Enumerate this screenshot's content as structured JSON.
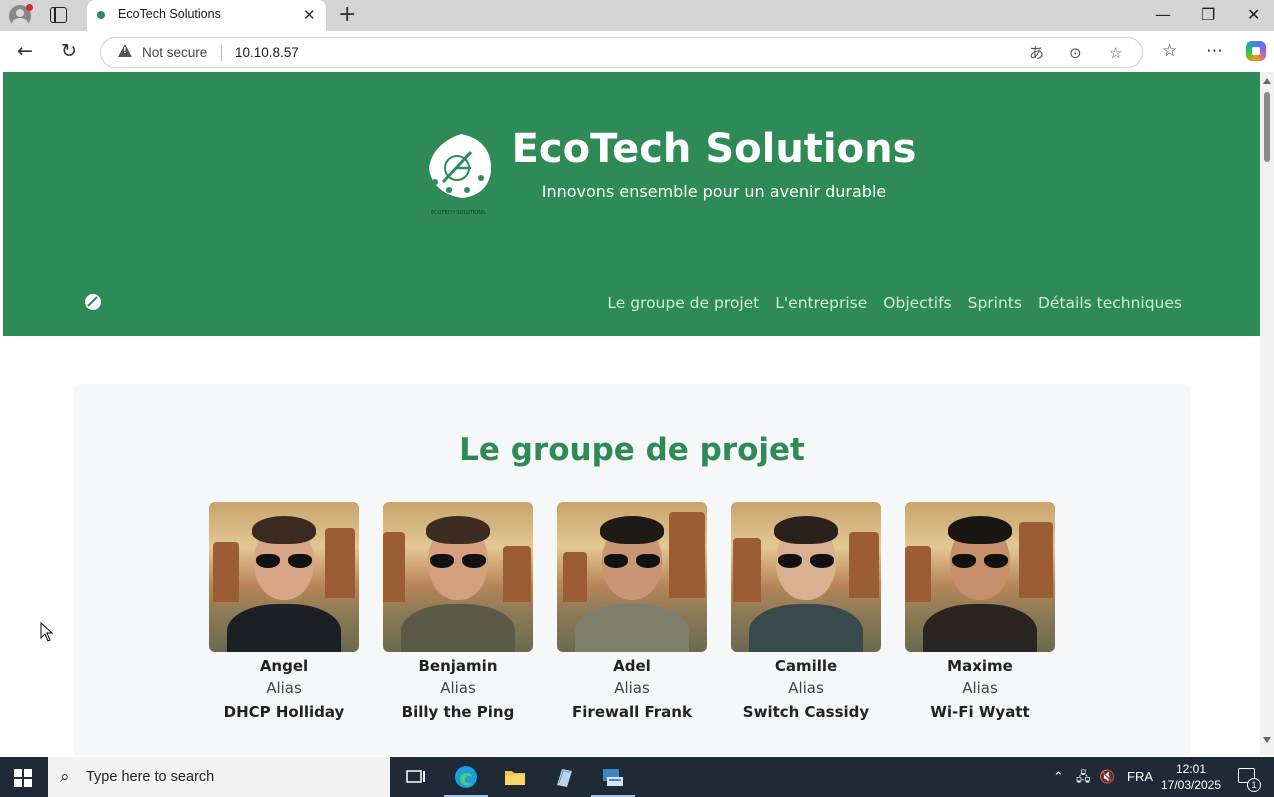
{
  "browser": {
    "tab_title": "EcoTech Solutions",
    "tab_close": "✕",
    "new_tab": "+",
    "security_label": "Not secure",
    "url": "10.10.8.57",
    "window_minimize": "—",
    "window_restore": "❐",
    "window_close": "✕"
  },
  "site": {
    "title": "EcoTech Solutions",
    "tagline": "Innovons ensemble pour un avenir durable",
    "logo_caption": "ECOTECH SOLUTIONS",
    "brand_color": "#2e8b57",
    "nav": [
      {
        "label": "Le groupe de projet"
      },
      {
        "label": "L'entreprise"
      },
      {
        "label": "Objectifs"
      },
      {
        "label": "Sprints"
      },
      {
        "label": "Détails techniques"
      }
    ]
  },
  "group": {
    "title": "Le groupe de projet",
    "members": [
      {
        "name": "Angel",
        "alias_label": "Alias",
        "alias": "DHCP Holliday",
        "shirt": "#1c1f24",
        "skin": "#d8a586",
        "hair": "#3a2a20"
      },
      {
        "name": "Benjamin",
        "alias_label": "Alias",
        "alias": "Billy the Ping",
        "shirt": "#5b5a47",
        "skin": "#d4a07e",
        "hair": "#3c2c22"
      },
      {
        "name": "Adel",
        "alias_label": "Alias",
        "alias": "Firewall Frank",
        "shirt": "#7d7e6c",
        "skin": "#c89674",
        "hair": "#1e1a18"
      },
      {
        "name": "Camille",
        "alias_label": "Alias",
        "alias": "Switch Cassidy",
        "shirt": "#3a4a4c",
        "skin": "#d9b192",
        "hair": "#2a211c"
      },
      {
        "name": "Maxime",
        "alias_label": "Alias",
        "alias": "Wi-Fi Wyatt",
        "shirt": "#2b2522",
        "skin": "#c68f6c",
        "hair": "#1a1614"
      }
    ]
  },
  "taskbar": {
    "search_placeholder": "Type here to search",
    "language": "FRA",
    "time": "12:01",
    "date": "17/03/2025",
    "notification_count": "1"
  }
}
